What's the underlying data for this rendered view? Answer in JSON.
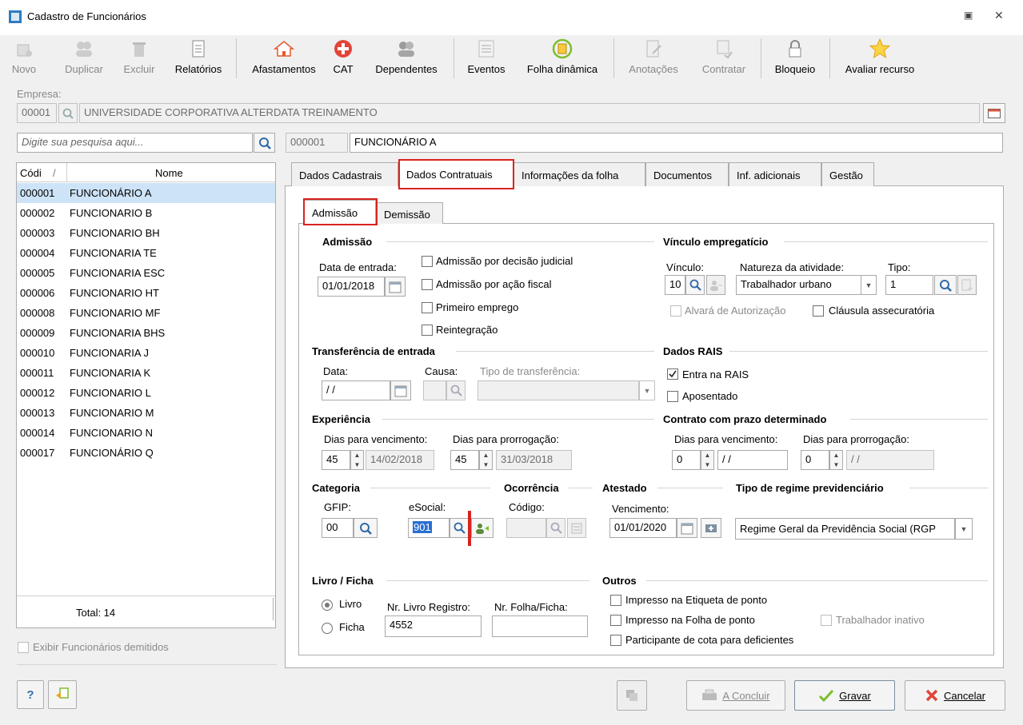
{
  "window": {
    "title": "Cadastro de Funcionários"
  },
  "toolbar": {
    "novo": "Novo",
    "duplicar": "Duplicar",
    "excluir": "Excluir",
    "relatorios": "Relatórios",
    "afastamentos": "Afastamentos",
    "cat": "CAT",
    "dependentes": "Dependentes",
    "eventos": "Eventos",
    "folha_dinamica": "Folha dinâmica",
    "anotacoes": "Anotações",
    "contratar": "Contratar",
    "bloqueio": "Bloqueio",
    "avaliar": "Avaliar recurso"
  },
  "empresa": {
    "label": "Empresa:",
    "code": "00001",
    "name": "UNIVERSIDADE CORPORATIVA ALTERDATA TREINAMENTO"
  },
  "search": {
    "placeholder": "Digite sua pesquisa aqui..."
  },
  "funcionario": {
    "code": "000001",
    "name": "FUNCIONÁRIO A"
  },
  "list": {
    "col_code": "Códi",
    "col_sort": "/",
    "col_name": "Nome",
    "total": "Total: 14",
    "rows": [
      {
        "code": "000001",
        "name": "FUNCIONÁRIO A"
      },
      {
        "code": "000002",
        "name": "FUNCIONARIO B"
      },
      {
        "code": "000003",
        "name": "FUNCIONARIO BH"
      },
      {
        "code": "000004",
        "name": "FUNCIONARIA TE"
      },
      {
        "code": "000005",
        "name": "FUNCIONARIA ESC"
      },
      {
        "code": "000006",
        "name": "FUNCIONARIO HT"
      },
      {
        "code": "000008",
        "name": "FUNCIONARIO MF"
      },
      {
        "code": "000009",
        "name": "FUNCIONARIA BHS"
      },
      {
        "code": "000010",
        "name": "FUNCIONARIA J"
      },
      {
        "code": "000011",
        "name": "FUNCIONARIA K"
      },
      {
        "code": "000012",
        "name": "FUNCIONARIO L"
      },
      {
        "code": "000013",
        "name": "FUNCIONARIO M"
      },
      {
        "code": "000014",
        "name": "FUNCIONARIO N"
      },
      {
        "code": "000017",
        "name": "FUNCIONÁRIO Q"
      }
    ]
  },
  "exibir_demitidos": "Exibir Funcionários demitidos",
  "tabs": [
    "Dados Cadastrais",
    "Dados Contratuais",
    "Informações da folha",
    "Documentos",
    "Inf. adicionais",
    "Gestão"
  ],
  "subtabs": [
    "Admissão",
    "Demissão"
  ],
  "admissao": {
    "title": "Admissão",
    "data_label": "Data de entrada:",
    "data": "01/01/2018",
    "chk1": "Admissão por decisão judicial",
    "chk2": "Admissão por ação fiscal",
    "chk3": "Primeiro emprego",
    "chk4": "Reintegração"
  },
  "vinculo": {
    "title": "Vínculo empregatício",
    "vinculo_label": "Vínculo:",
    "vinculo": "10",
    "natureza_label": "Natureza da atividade:",
    "natureza": "Trabalhador urbano",
    "tipo_label": "Tipo:",
    "tipo": "1",
    "alvara": "Alvará de Autorização",
    "clausula": "Cláusula assecuratória"
  },
  "transferencia": {
    "title": "Transferência de entrada",
    "data_label": "Data:",
    "data": " / /",
    "causa_label": "Causa:",
    "tipo_label": "Tipo de transferência:"
  },
  "rais": {
    "title": "Dados RAIS",
    "entra": "Entra na RAIS",
    "aposentado": "Aposentado"
  },
  "experiencia": {
    "title": "Experiência",
    "dias_venc_label": "Dias para vencimento:",
    "dias_prorr_label": "Dias para prorrogação:",
    "dias_venc": "45",
    "data_venc": "14/02/2018",
    "dias_prorr": "45",
    "data_prorr": "31/03/2018"
  },
  "contrato": {
    "title": "Contrato com prazo determinado",
    "dias_venc_label": "Dias para vencimento:",
    "dias_prorr_label": "Dias para prorrogação:",
    "dias_venc": "0",
    "data_venc": " / /",
    "dias_prorr": "0",
    "data_prorr": " / /"
  },
  "categoria": {
    "title": "Categoria",
    "gfip_label": "GFIP:",
    "gfip": "00",
    "esocial_label": "eSocial:",
    "esocial": "901"
  },
  "ocorrencia": {
    "title": "Ocorrência",
    "codigo_label": "Código:"
  },
  "atestado": {
    "title": "Atestado",
    "venc_label": "Vencimento:",
    "venc": "01/01/2020"
  },
  "regime": {
    "title": "Tipo de regime previdenciário",
    "value": "Regime Geral da Previdência Social (RGP"
  },
  "livro": {
    "title": "Livro / Ficha",
    "livro": "Livro",
    "ficha": "Ficha",
    "nr_livro_label": "Nr. Livro Registro:",
    "nr_livro": "4552",
    "nr_folha_label": "Nr. Folha/Ficha:"
  },
  "outros": {
    "title": "Outros",
    "etiqueta": "Impresso na Etiqueta de ponto",
    "folha": "Impresso na Folha de ponto",
    "inativo": "Trabalhador inativo",
    "cota": "Participante de cota para deficientes"
  },
  "buttons": {
    "help": "?",
    "concluir": "A Concluir",
    "gravar": "Gravar",
    "cancelar": "Cancelar"
  }
}
